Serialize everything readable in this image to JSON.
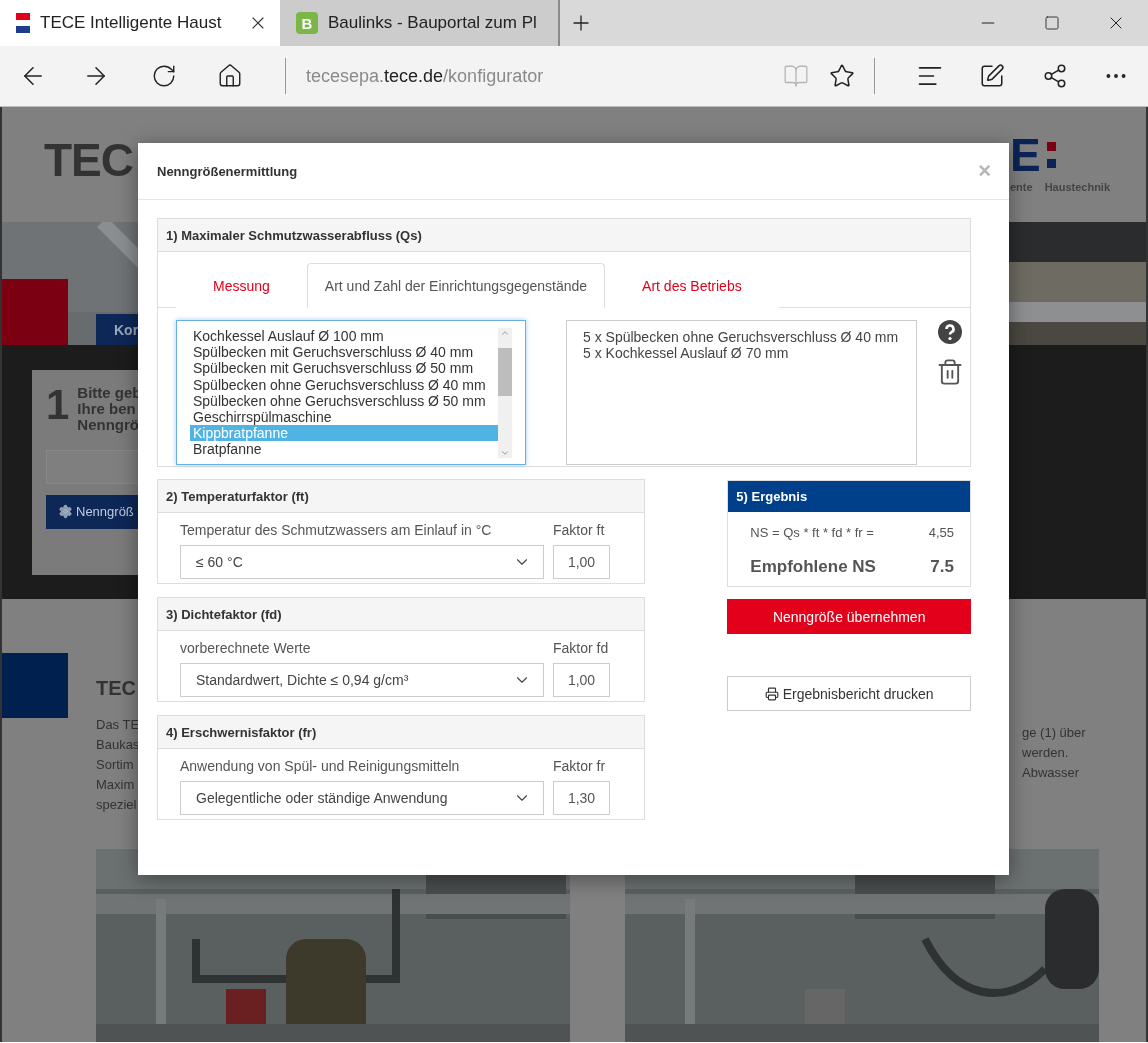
{
  "browser": {
    "tabs": [
      {
        "title": "TECE Intelligente Haust",
        "selected": true,
        "kind": "flag"
      },
      {
        "title": "Baulinks - Bauportal zum Pl",
        "selected": false,
        "kind": "letter",
        "icon_text": "B"
      }
    ],
    "url": {
      "subdomain": "tecesepa.",
      "domain": "tece.de",
      "path": "/konfigurator"
    },
    "reading_view": {
      "disabled": true
    }
  },
  "background_page": {
    "logo_left": "TEC",
    "logo_right": "E",
    "logo_right_tagline": [
      "ente",
      "Haustechnik"
    ],
    "hero_tab": "Kor",
    "step_number": "1",
    "step_text": [
      "Bitte geb",
      "Ihre ben",
      "Nenngrö"
    ],
    "step_button": "Nenngröß",
    "section_title": "TEC",
    "paragraph_left": [
      "Das TE",
      "Baukas",
      "Sortim",
      "Maxim",
      "speziel"
    ],
    "paragraph_right": [
      "ge (1) über",
      "werden.",
      "Abwasser"
    ]
  },
  "dialog": {
    "title": "Nenngrößenermittlung",
    "close": "×",
    "discharge": {
      "heading": "1) Maximaler Schmutzwasserabfluss (Qs)",
      "tabs": [
        {
          "label": "Messung",
          "selected": false
        },
        {
          "label": "Art und Zahl der Einrichtungsgegenstände",
          "selected": true
        },
        {
          "label": "Art des Betriebs",
          "selected": false
        }
      ],
      "fixtures": [
        {
          "label": "Kochkessel Auslauf Ø 100 mm",
          "selected": false
        },
        {
          "label": "Spülbecken mit Geruchsverschluss Ø 40 mm",
          "selected": false
        },
        {
          "label": "Spülbecken mit Geruchsverschluss Ø 50 mm",
          "selected": false
        },
        {
          "label": "Spülbecken ohne Geruchsverschluss Ø 40 mm",
          "selected": false
        },
        {
          "label": "Spülbecken ohne Geruchsverschluss Ø 50 mm",
          "selected": false
        },
        {
          "label": "Geschirrspülmaschine",
          "selected": false
        },
        {
          "label": "Kippbratpfanne",
          "selected": true
        },
        {
          "label": "Bratpfanne",
          "selected": false
        }
      ],
      "chosen": [
        "5 x Spülbecken ohne Geruchsverschluss Ø 40 mm",
        "5 x Kochkessel Auslauf Ø 70 mm"
      ]
    },
    "factors": [
      {
        "heading": "2) Temperaturfaktor (ft)",
        "field_label": "Temperatur des Schmutzwassers am Einlauf in °C",
        "select": "≤ 60 °C",
        "value_label": "Faktor ft",
        "value": "1,00"
      },
      {
        "heading": "3) Dichtefaktor (fd)",
        "field_label": "vorberechnete Werte",
        "select": "Standardwert, Dichte ≤ 0,94 g/cm³",
        "value_label": "Faktor fd",
        "value": "1,00"
      },
      {
        "heading": "4) Erschwernisfaktor (fr)",
        "field_label": "Anwendung von Spül- und Reinigungsmitteln",
        "select": "Gelegentliche oder ständige Anwendung",
        "value_label": "Faktor fr",
        "value": "1,30"
      }
    ],
    "result": {
      "heading": "5) Ergebnis",
      "formula": "NS = Qs * ft * fd * fr =",
      "formula_value": "4,55",
      "recommended_label": "Empfohlene NS",
      "recommended_value": "7.5"
    },
    "apply_button": "Nenngröße übernehmen",
    "print_button": "Ergebnisbericht drucken"
  }
}
